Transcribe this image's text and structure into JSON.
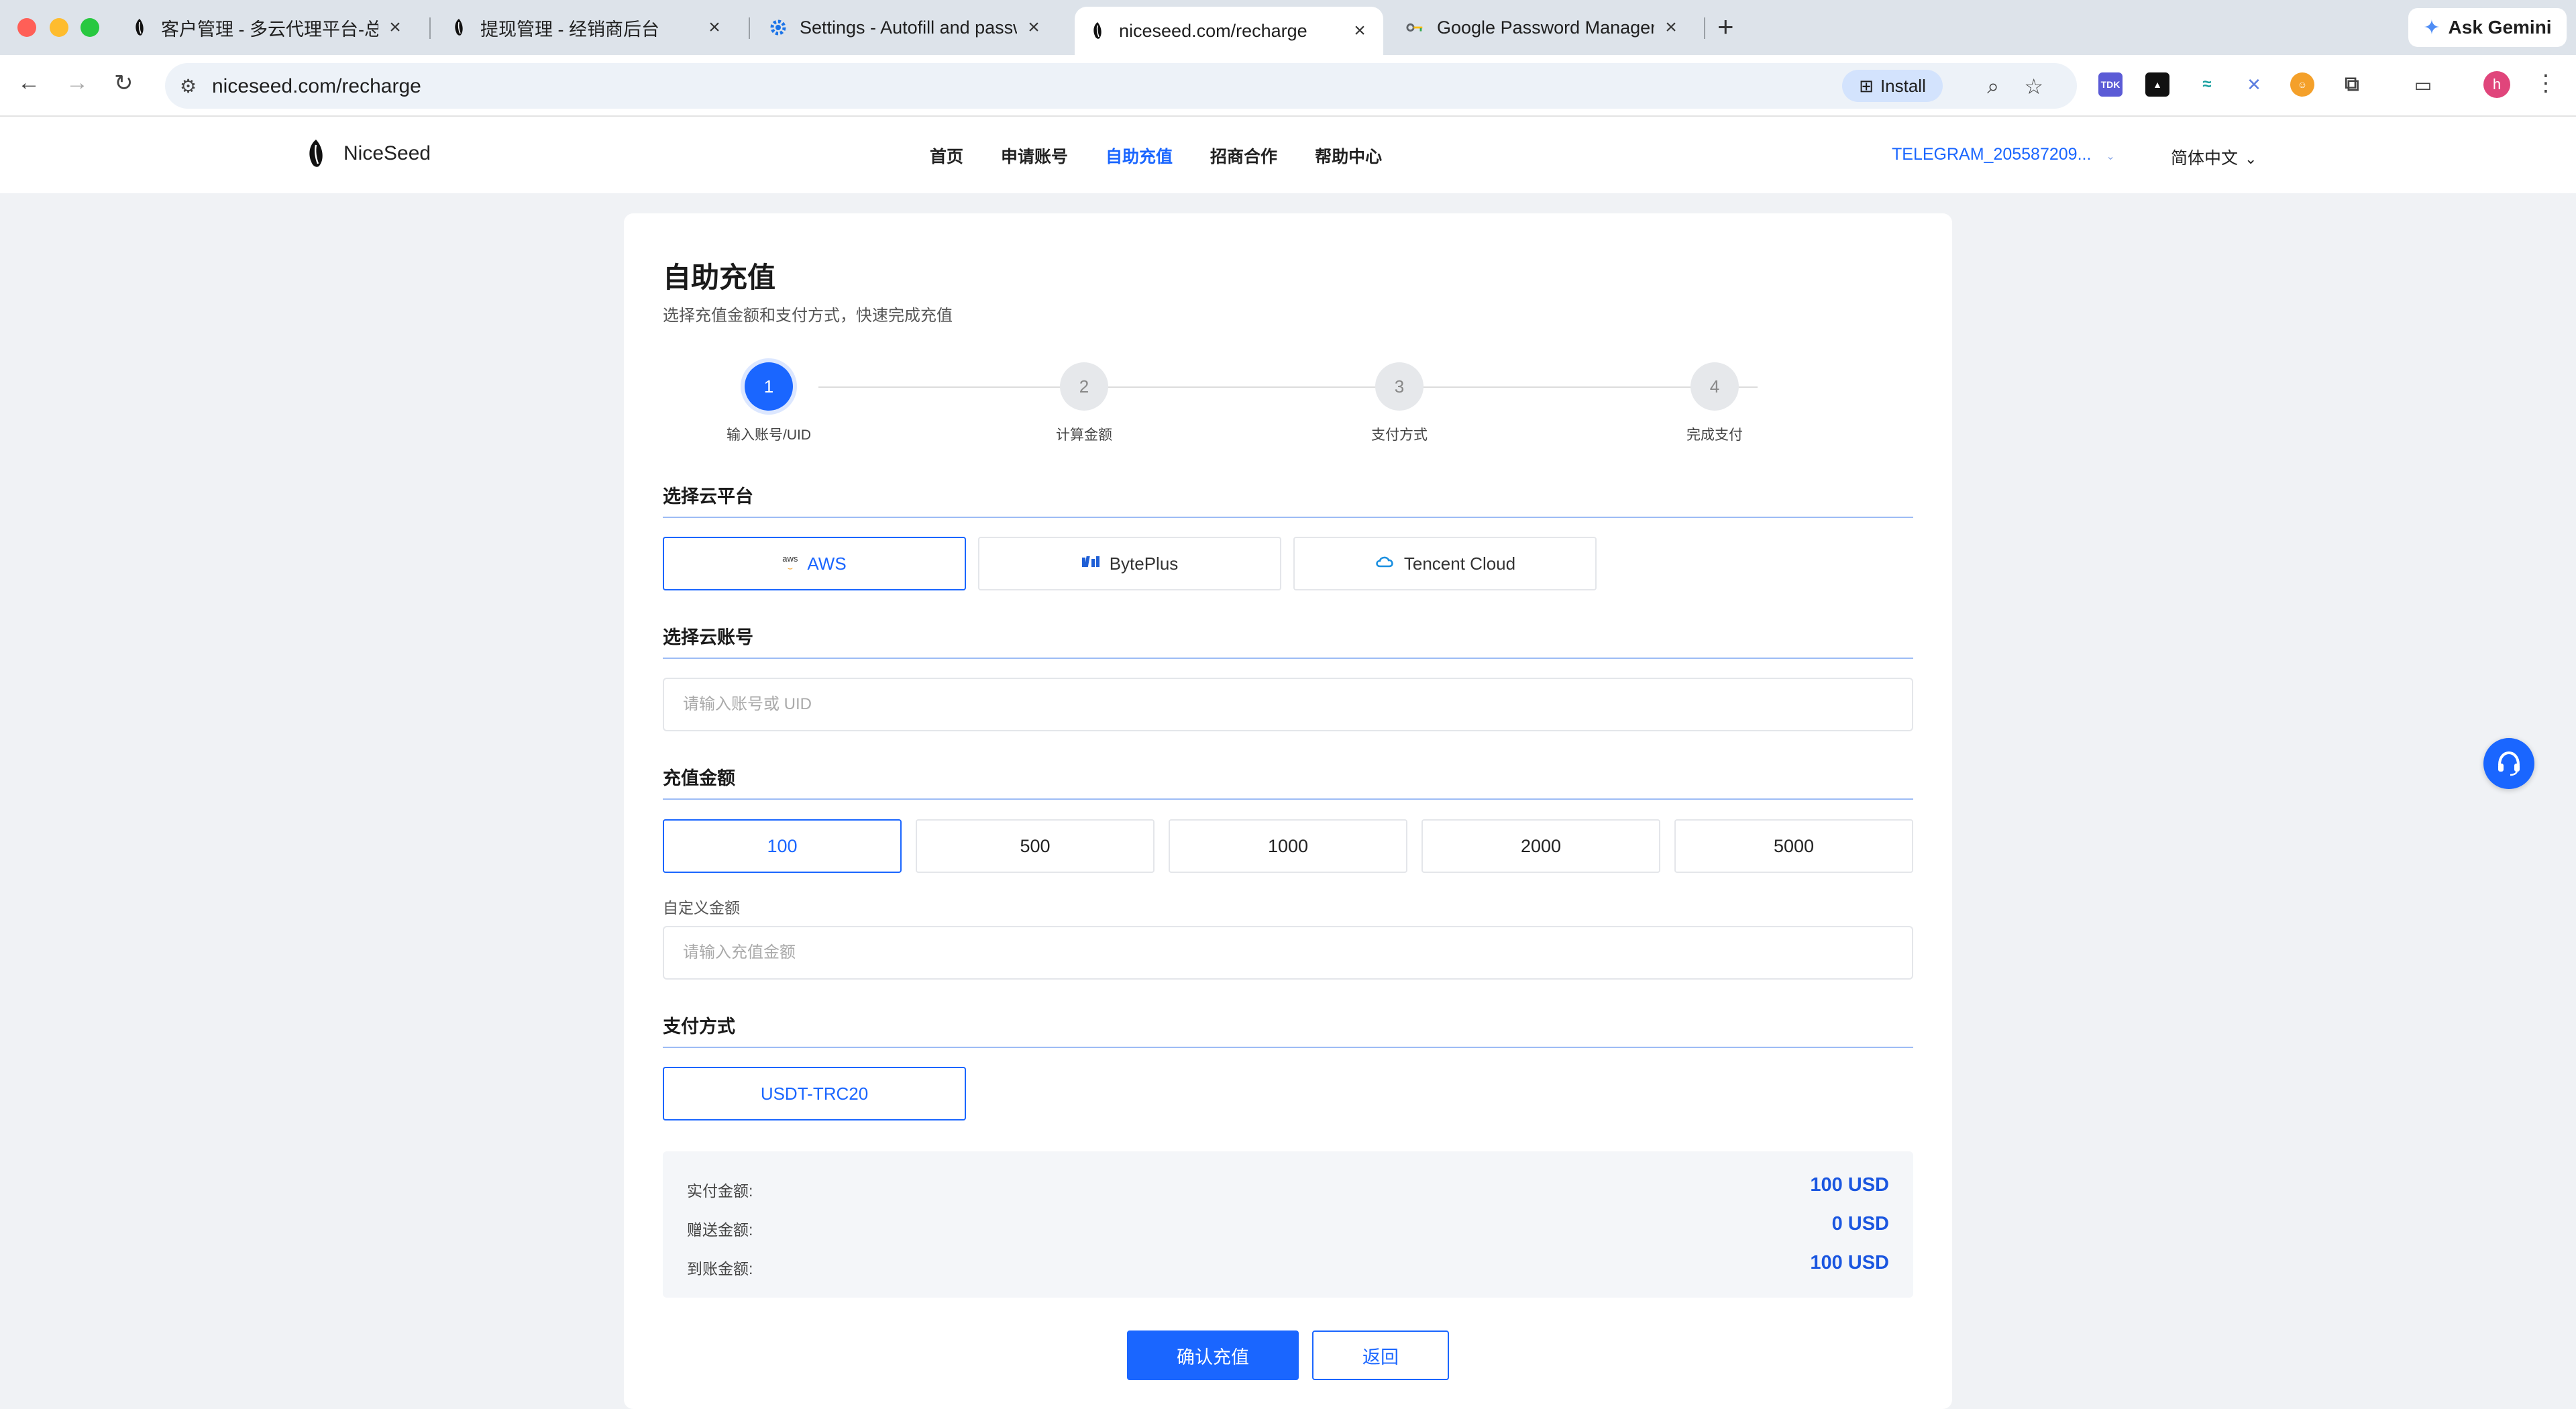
{
  "browser": {
    "tabs": [
      {
        "title": "客户管理 - 多云代理平台-总后台",
        "icon": "niceseed-logo-icon"
      },
      {
        "title": "提现管理 - 经销商后台",
        "icon": "niceseed-logo-icon"
      },
      {
        "title": "Settings - Autofill and passwords",
        "icon": "gear-icon"
      },
      {
        "title": "niceseed.com/recharge",
        "icon": "niceseed-logo-icon",
        "active": true
      },
      {
        "title": "Google Password Manager",
        "icon": "key-icon"
      }
    ],
    "new_tab_label": "+",
    "gemini_label": "Ask Gemini",
    "url": "niceseed.com/recharge",
    "install_label": "Install",
    "profile_initial": "h",
    "extension_label": "TDK"
  },
  "site": {
    "brand": "NiceSeed",
    "nav": [
      {
        "label": "首页",
        "active": false
      },
      {
        "label": "申请账号",
        "active": false
      },
      {
        "label": "自助充值",
        "active": true
      },
      {
        "label": "招商合作",
        "active": false
      },
      {
        "label": "帮助中心",
        "active": false
      }
    ],
    "user": "TELEGRAM_205587209...",
    "language": "简体中文"
  },
  "page": {
    "title": "自助充值",
    "subtitle": "选择充值金额和支付方式，快速完成充值",
    "steps": [
      {
        "num": "1",
        "label": "输入账号/UID",
        "active": true
      },
      {
        "num": "2",
        "label": "计算金额",
        "active": false
      },
      {
        "num": "3",
        "label": "支付方式",
        "active": false
      },
      {
        "num": "4",
        "label": "完成支付",
        "active": false
      }
    ],
    "platform_section": "选择云平台",
    "platforms": [
      {
        "label": "AWS",
        "icon": "aws-logo-icon",
        "selected": true
      },
      {
        "label": "BytePlus",
        "icon": "byteplus-logo-icon",
        "selected": false
      },
      {
        "label": "Tencent Cloud",
        "icon": "tencent-cloud-icon",
        "selected": false
      }
    ],
    "aws_mark": "aws",
    "account_section": "选择云账号",
    "account_placeholder": "请输入账号或 UID",
    "amount_section": "充值金额",
    "amounts": [
      {
        "label": "100",
        "selected": true
      },
      {
        "label": "500",
        "selected": false
      },
      {
        "label": "1000",
        "selected": false
      },
      {
        "label": "2000",
        "selected": false
      },
      {
        "label": "5000",
        "selected": false
      }
    ],
    "custom_label": "自定义金额",
    "custom_placeholder": "请输入充值金额",
    "payment_section": "支付方式",
    "payment_method": "USDT-TRC20",
    "summary": [
      {
        "key": "实付金额:",
        "value": "100 USD"
      },
      {
        "key": "赠送金额:",
        "value": "0 USD"
      },
      {
        "key": "到账金额:",
        "value": "100 USD"
      }
    ],
    "confirm_label": "确认充值",
    "back_label": "返回"
  },
  "colors": {
    "accent": "#1a66ff",
    "section_line": "#9dbcf5",
    "page_bg": "#f0f2f5"
  }
}
